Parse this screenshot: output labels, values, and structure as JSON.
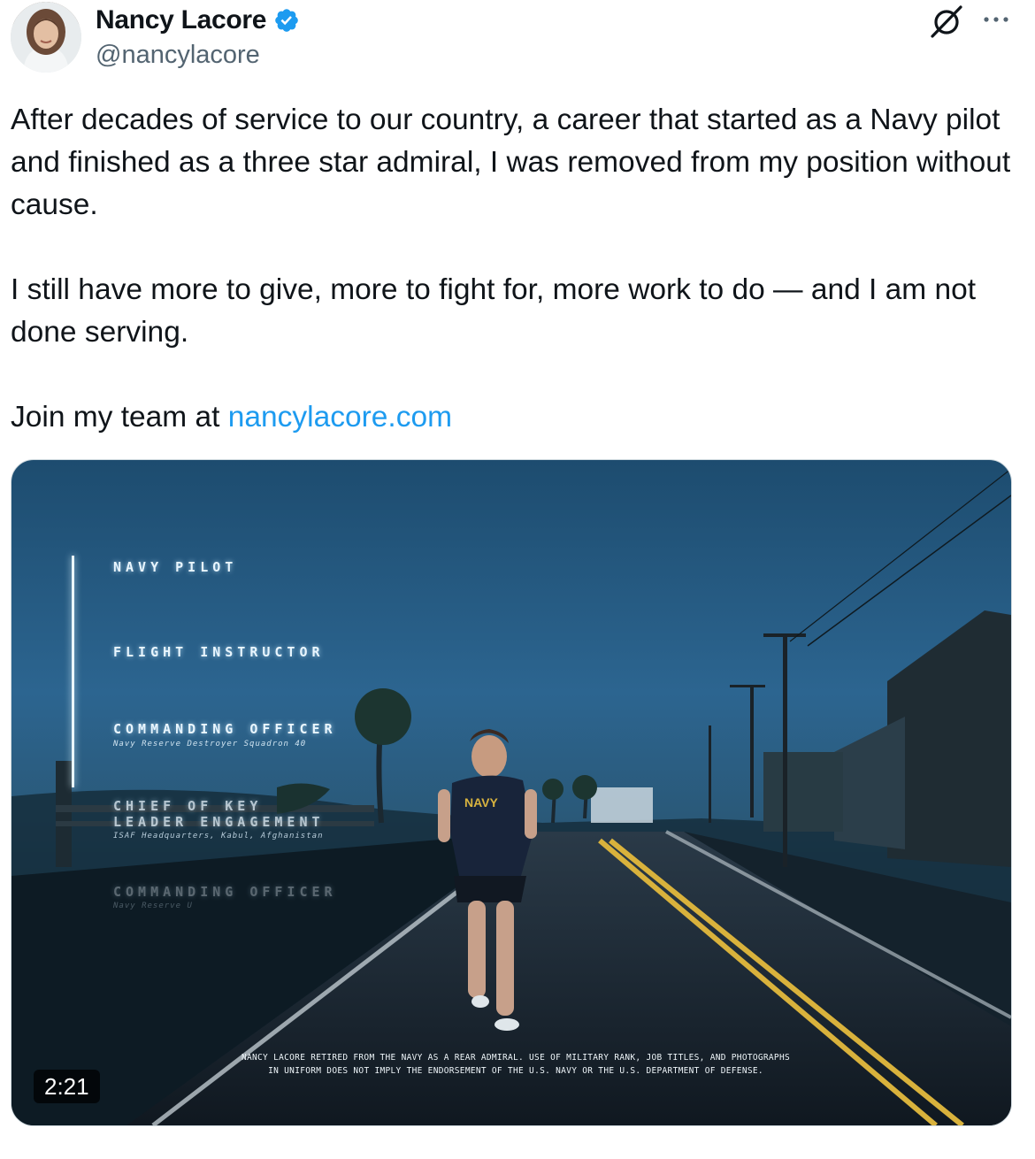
{
  "author": {
    "name": "Nancy Lacore",
    "handle": "@nancylacore",
    "verified": true,
    "avatar_icon": "avatar-photo"
  },
  "tweet": {
    "paragraph1": "After decades of service to our country, a career that started as a Navy pilot and finished as a three star admiral, I was removed from my position without cause.",
    "paragraph2": "I still have more to give, more to fight for, more work to do — and I am not done serving.",
    "paragraph3_prefix": "Join my team at ",
    "link_text": "nancylacore.com"
  },
  "video": {
    "duration": "2:21",
    "overlay": {
      "item1": "NAVY PILOT",
      "item2": "FLIGHT INSTRUCTOR",
      "item3": "COMMANDING OFFICER",
      "item3_sub": "Navy Reserve Destroyer Squadron 40",
      "item4a": "CHIEF OF KEY",
      "item4b": "LEADER ENGAGEMENT",
      "item4_sub": "ISAF Headquarters, Kabul, Afghanistan",
      "item5": "COMMANDING OFFICER",
      "item5_sub": "Navy Reserve U",
      "shirt_text": "NAVY"
    },
    "disclaimer_line1": "NANCY LACORE RETIRED FROM THE NAVY AS A REAR ADMIRAL. USE OF MILITARY RANK, JOB TITLES, AND PHOTOGRAPHS",
    "disclaimer_line2": "IN UNIFORM DOES NOT IMPLY THE ENDORSEMENT OF THE U.S. NAVY OR THE U.S. DEPARTMENT OF DEFENSE."
  },
  "colors": {
    "link": "#1d9bf0",
    "verified": "#1d9bf0",
    "secondary_text": "#536471"
  }
}
